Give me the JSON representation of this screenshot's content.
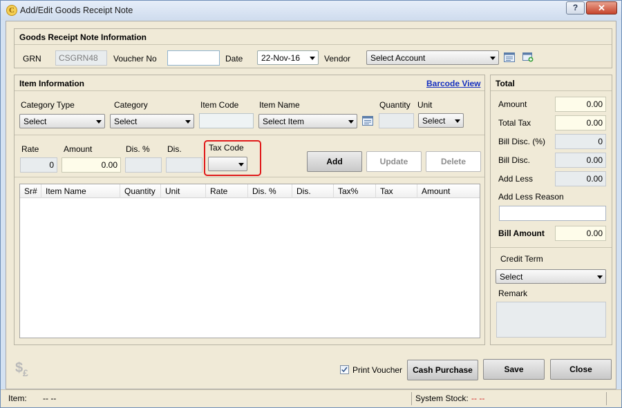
{
  "window": {
    "title": "Add/Edit Goods Receipt Note",
    "help_label": "?",
    "close_label": "✕"
  },
  "grn_info": {
    "title": "Goods Receipt Note Information",
    "grn_label": "GRN",
    "grn_value": "CSGRN48",
    "voucher_label": "Voucher No",
    "voucher_value": "",
    "date_label": "Date",
    "date_value": "22-Nov-16",
    "vendor_label": "Vendor",
    "vendor_value": "Select Account"
  },
  "item_info": {
    "title": "Item Information",
    "barcode_link": "Barcode View",
    "category_type_label": "Category Type",
    "category_type_value": "Select",
    "category_label": "Category",
    "category_value": "Select",
    "item_code_label": "Item Code",
    "item_code_value": "",
    "item_name_label": "Item Name",
    "item_name_value": "Select Item",
    "quantity_label": "Quantity",
    "quantity_value": "",
    "unit_label": "Unit",
    "unit_value": "Select",
    "rate_label": "Rate",
    "rate_value": "0",
    "amount_label": "Amount",
    "amount_value": "0.00",
    "dis_pct_label": "Dis. %",
    "dis_pct_value": "",
    "dis_label": "Dis.",
    "dis_value": "",
    "tax_code_label": "Tax Code",
    "tax_code_value": "",
    "add_label": "Add",
    "update_label": "Update",
    "delete_label": "Delete"
  },
  "grid": {
    "columns": [
      "Sr#",
      "Item Name",
      "Quantity",
      "Unit",
      "Rate",
      "Dis. %",
      "Dis.",
      "Tax%",
      "Tax",
      "Amount"
    ],
    "rows": []
  },
  "total": {
    "title": "Total",
    "amount_label": "Amount",
    "amount_value": "0.00",
    "total_tax_label": "Total Tax",
    "total_tax_value": "0.00",
    "bill_disc_pct_label": "Bill Disc. (%)",
    "bill_disc_pct_value": "0",
    "bill_disc_label": "Bill Disc.",
    "bill_disc_value": "0.00",
    "add_less_label": "Add Less",
    "add_less_value": "0.00",
    "add_less_reason_label": "Add Less Reason",
    "add_less_reason_value": "",
    "bill_amount_label": "Bill Amount",
    "bill_amount_value": "0.00",
    "credit_term_label": "Credit Term",
    "credit_term_value": "Select",
    "remark_label": "Remark",
    "remark_value": ""
  },
  "footer": {
    "print_voucher_label": "Print Voucher",
    "print_voucher_checked": true,
    "cash_purchase_label": "Cash Purchase",
    "save_label": "Save",
    "close_label": "Close"
  },
  "statusbar": {
    "item_label": "Item:",
    "item_value": "-- --",
    "stock_label": "System Stock:",
    "stock_value": "-- --"
  },
  "colors": {
    "highlight": "#e0191a",
    "link": "#1530c0",
    "stock_value": "#d22222"
  }
}
